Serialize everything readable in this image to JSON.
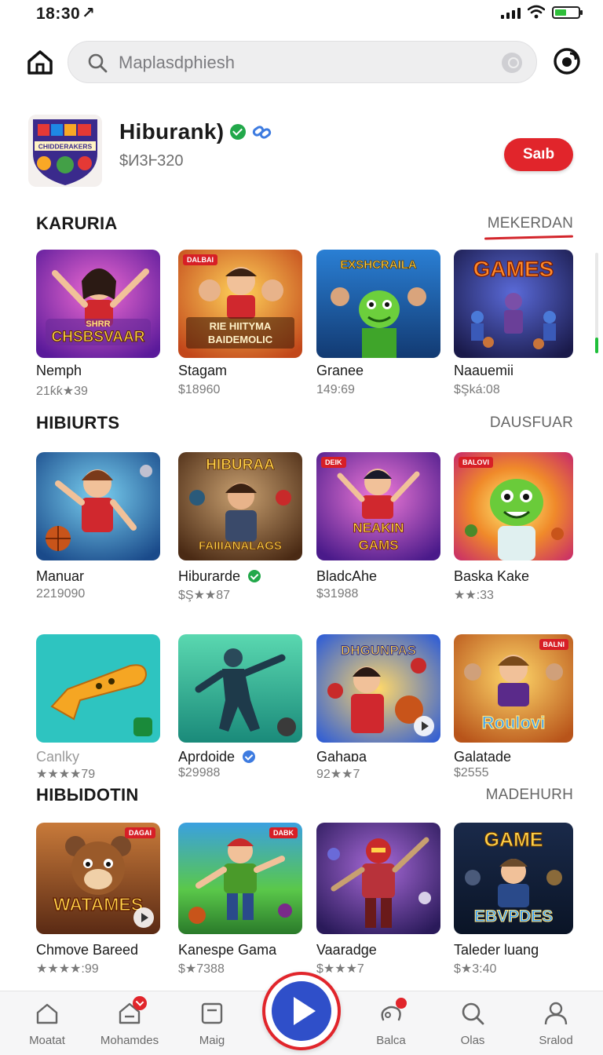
{
  "status_bar": {
    "time": "18:30",
    "arrow_glyph": "↗",
    "battery_color": "#2fbf3a"
  },
  "top_bar": {
    "search_placeholder": "Maplasdphiesh",
    "icons": [
      "home-icon",
      "search-icon",
      "mic-icon",
      "profile-icon"
    ]
  },
  "app_header": {
    "title": "Hiburank)",
    "subtitle": "$И3Ⱶ320",
    "logo_text": "CHIDDERAKERS",
    "subscribe_label": "Saıb",
    "accent_color": "#e1252b"
  },
  "sections": [
    {
      "title": "KARURIA",
      "more": "MEKERDAN",
      "items": [
        {
          "name": "Nemph",
          "meta": "21ƙƙ★39",
          "art_text": "CHSBSVAAR",
          "art_top": "SHRR",
          "theme": "purple"
        },
        {
          "name": "Stagam",
          "meta": "$18960",
          "art_text": "BAIDEMOLIC",
          "art_top": "RIE HIITYMA",
          "theme": "orange",
          "tag": "DALBAI"
        },
        {
          "name": "Granee",
          "meta": "149:69",
          "art_text": "",
          "art_top": "EXSHCRAILA",
          "theme": "blue"
        },
        {
          "name": "Naauemii",
          "meta": "$Şká:08",
          "art_text": "",
          "art_top": "GAMES",
          "theme": "navy"
        }
      ]
    },
    {
      "title": "HIBIURTS",
      "more": "DAUSFUAR",
      "items": [
        {
          "name": "Manuar",
          "meta": "2219090",
          "art_text": "",
          "art_top": "",
          "theme": "skyblue"
        },
        {
          "name": "Hiburarde",
          "meta": "$Ş★★87",
          "art_text": "FAIIIANALAGS",
          "art_top": "HIBURAA",
          "theme": "brown",
          "badge": "green"
        },
        {
          "name": "BladcAhe",
          "meta": "$31988",
          "art_text": "GAMS",
          "art_top": "NEAKIN",
          "theme": "magenta",
          "tag": "DEIK"
        },
        {
          "name": "Baska Kake",
          "meta": "★★:33",
          "art_text": "",
          "art_top": "",
          "theme": "sunburst",
          "tag": "BALOVI"
        }
      ]
    },
    {
      "title": "",
      "more": "",
      "items": [
        {
          "name": "Canlky",
          "meta": "★★★★79",
          "art_text": "",
          "art_top": "",
          "theme": "teal",
          "faded": true
        },
        {
          "name": "Aprdoide",
          "meta": "$29988",
          "art_text": "",
          "art_top": "",
          "theme": "mint",
          "badge": "blue"
        },
        {
          "name": "Gahaɒa",
          "meta": "92★★7",
          "art_text": "",
          "art_top": "DHGUNPAS",
          "theme": "redblue",
          "play": true
        },
        {
          "name": "Galatade",
          "meta": "$2555",
          "art_text": "Roulovi",
          "art_top": "",
          "theme": "gold",
          "tag": "BALNI"
        }
      ]
    },
    {
      "title": "HIBЫDOTIN",
      "more": "MADEHURH",
      "items": [
        {
          "name": "Chmove Bareed",
          "meta": "★★★★:99",
          "art_text": "WATAMES",
          "art_top": "",
          "theme": "bear",
          "tag": "DAGAI",
          "play": true
        },
        {
          "name": "Kanespe Gama",
          "meta": "$★7388",
          "art_text": "",
          "art_top": "",
          "theme": "field",
          "tag": "DABK"
        },
        {
          "name": "Vaaradge",
          "meta": "$★★★7",
          "art_text": "",
          "art_top": "",
          "theme": "purple2"
        },
        {
          "name": "Taleder luang",
          "meta": "$★3:40",
          "art_text": "EBVPDES",
          "art_top": "GAME",
          "theme": "dark"
        }
      ]
    }
  ],
  "bottom_nav": [
    {
      "label": "Moatat",
      "icon": "home-icon"
    },
    {
      "label": "Mohamdes",
      "icon": "inbox-icon",
      "badge": true
    },
    {
      "label": "Maig",
      "icon": "library-icon"
    },
    {
      "label": "",
      "icon": "play-icon",
      "center": true
    },
    {
      "label": "Balca",
      "icon": "controller-icon",
      "dot": true
    },
    {
      "label": "Olas",
      "icon": "search-icon"
    },
    {
      "label": "Sralod",
      "icon": "person-icon"
    }
  ]
}
